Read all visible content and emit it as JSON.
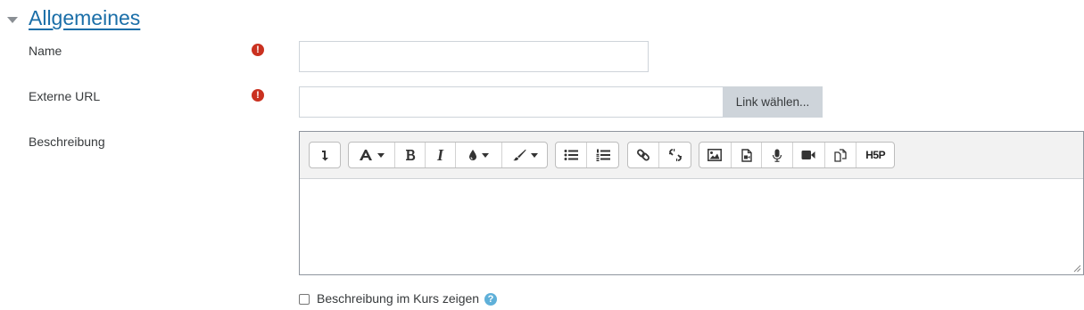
{
  "section": {
    "title": "Allgemeines",
    "caret_icon": "caret-down-icon"
  },
  "fields": {
    "name": {
      "label": "Name",
      "value": "",
      "required_icon": "!"
    },
    "url": {
      "label": "Externe URL",
      "value": "",
      "required_icon": "!",
      "choose_link_label": "Link wählen..."
    },
    "description": {
      "label": "Beschreibung"
    }
  },
  "toolbar": {
    "italic": "I",
    "h5p": "H5P",
    "buttons": [
      "collapse-icon",
      "font-family-icon",
      "bold-icon",
      "italic-icon",
      "text-color-icon",
      "background-color-icon",
      "unordered-list-icon",
      "ordered-list-icon",
      "link-icon",
      "unlink-icon",
      "image-icon",
      "media-icon",
      "microphone-icon",
      "video-icon",
      "manage-files-icon",
      "h5p-icon"
    ]
  },
  "show_description": {
    "label": "Beschreibung im Kurs zeigen",
    "checked": false,
    "help_icon": "?"
  },
  "colors": {
    "link": "#1a6ea8",
    "required": "#ca3120",
    "help": "#5fb0d9"
  }
}
